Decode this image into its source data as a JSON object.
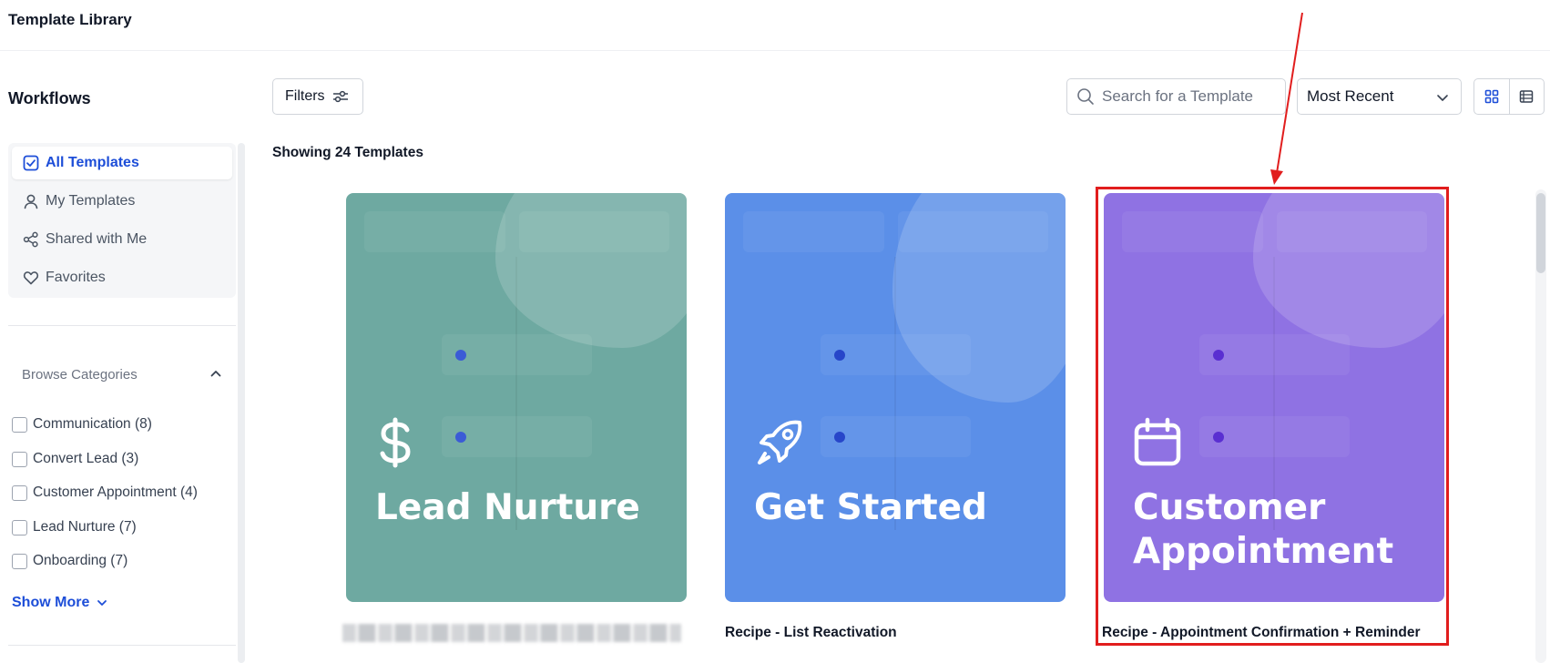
{
  "header": {
    "title": "Template Library"
  },
  "sidebar": {
    "section_title": "Workflows",
    "nav": [
      {
        "label": "All Templates",
        "icon": "checkbox-icon",
        "active": true
      },
      {
        "label": "My Templates",
        "icon": "user-icon",
        "active": false
      },
      {
        "label": "Shared with Me",
        "icon": "share-icon",
        "active": false
      },
      {
        "label": "Favorites",
        "icon": "heart-icon",
        "active": false
      }
    ],
    "browse_title": "Browse Categories",
    "categories": [
      {
        "label": "Communication (8)",
        "checked": false
      },
      {
        "label": "Convert Lead (3)",
        "checked": false
      },
      {
        "label": "Customer Appointment (4)",
        "checked": false
      },
      {
        "label": "Lead Nurture (7)",
        "checked": false
      },
      {
        "label": "Onboarding (7)",
        "checked": false
      }
    ],
    "show_more": "Show More"
  },
  "toolbar": {
    "filters_label": "Filters",
    "search_placeholder": "Search for a Template",
    "sort_value": "Most Recent"
  },
  "main": {
    "showing_text": "Showing 24 Templates",
    "cards": [
      {
        "title": "Lead Nurture",
        "icon": "dollar-icon",
        "color": "#6ea9a1",
        "caption": ""
      },
      {
        "title": "Get Started",
        "icon": "rocket-icon",
        "color": "#5b8fe8",
        "caption": "Recipe - List Reactivation"
      },
      {
        "title": "Customer Appointment",
        "icon": "calendar-icon",
        "color": "#8f72e3",
        "caption": "Recipe - Appointment Confirmation + Reminder"
      }
    ]
  },
  "colors": {
    "accent": "#1d4ed8",
    "highlight": "#e11d1d",
    "card_green": "#6ea9a1",
    "card_blue": "#5b8fe8",
    "card_purple": "#8f72e3"
  }
}
